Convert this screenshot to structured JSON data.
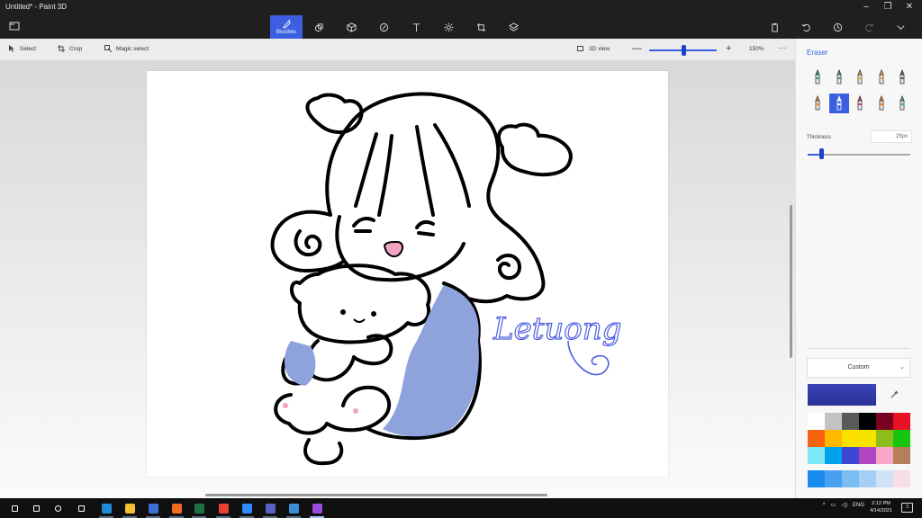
{
  "window": {
    "title": "Untitled* - Paint 3D",
    "minimize_glyph": "–",
    "maximize_glyph": "❐",
    "close_glyph": "✕"
  },
  "main_toolbar": {
    "menu_icon": "hamburger-folder-icon",
    "tools": [
      {
        "name": "brushes",
        "label": "Brushes",
        "icon": "brush-icon",
        "active": true
      },
      {
        "name": "2d-shapes",
        "label": "",
        "icon": "2d-shapes-icon",
        "active": false
      },
      {
        "name": "3d-shapes",
        "label": "",
        "icon": "cube-icon",
        "active": false
      },
      {
        "name": "stickers",
        "label": "",
        "icon": "sticker-icon",
        "active": false
      },
      {
        "name": "text",
        "label": "",
        "icon": "text-icon",
        "active": false
      },
      {
        "name": "effects",
        "label": "",
        "icon": "sun-effects-icon",
        "active": false
      },
      {
        "name": "canvas",
        "label": "",
        "icon": "canvas-icon",
        "active": false
      },
      {
        "name": "3d-library",
        "label": "",
        "icon": "library-icon",
        "active": false
      }
    ],
    "right_actions": [
      "paste-icon",
      "undo-icon",
      "history-icon",
      "redo-icon",
      "chevron-down-icon"
    ]
  },
  "sub_toolbar": {
    "select_label": "Select",
    "crop_label": "Crop",
    "magic_select_label": "Magic select",
    "view_3d_label": "3D view",
    "zoom_minus": "—",
    "zoom_plus": "+",
    "zoom_value": "150%",
    "more": "···"
  },
  "drawing": {
    "signature": "Letuong"
  },
  "panel": {
    "title": "Eraser",
    "brushes": [
      {
        "name": "marker",
        "color": "#2a9d8f"
      },
      {
        "name": "calligraphy-pen",
        "color": "#3a9a8a"
      },
      {
        "name": "oil-brush",
        "color": "#e3a21a"
      },
      {
        "name": "watercolor",
        "color": "#f2a33a"
      },
      {
        "name": "pixel-pen",
        "color": "#555f6b"
      },
      {
        "name": "pencil",
        "color": "#e28a1f"
      },
      {
        "name": "eraser",
        "color": "#ffffff",
        "selected": true
      },
      {
        "name": "crayon",
        "color": "#e03b5a"
      },
      {
        "name": "spray-can",
        "color": "#f07a1a"
      },
      {
        "name": "fill",
        "color": "#4aa7a0"
      }
    ],
    "thickness_label": "Thickness",
    "thickness_value": "25px",
    "thickness_fraction": 0.14,
    "color_mode": "Custom",
    "current_color": "#3b44b8",
    "palette": [
      "#ffffff",
      "#c3c3c3",
      "#595959",
      "#000000",
      "#7a0020",
      "#e81123",
      "#f7630c",
      "#ffb900",
      "#fce100",
      "#f7e300",
      "#8cbd18",
      "#16c60c",
      "#7ce8f5",
      "#00a2ed",
      "#3f46d4",
      "#b146c2",
      "#f7a8c6",
      "#b57f5b"
    ],
    "palette_custom": [
      "#1a8cf0",
      "#4aa0f0",
      "#7bbcf2",
      "#a5cff4",
      "#cfe2f6",
      "#f8dce6"
    ]
  },
  "taskbar": {
    "apps": [
      {
        "name": "start",
        "color": "#ffffff"
      },
      {
        "name": "search",
        "color": "#ffffff"
      },
      {
        "name": "cortana",
        "color": "#ffffff"
      },
      {
        "name": "task-view",
        "color": "#ffffff"
      },
      {
        "name": "edge",
        "color": "#1f8ad6"
      },
      {
        "name": "file-explorer",
        "color": "#f2c230"
      },
      {
        "name": "store",
        "color": "#3a6fd6"
      },
      {
        "name": "firefox",
        "color": "#f26b21"
      },
      {
        "name": "excel",
        "color": "#1e7145"
      },
      {
        "name": "chrome",
        "color": "#e94235"
      },
      {
        "name": "zoom",
        "color": "#2d8cff"
      },
      {
        "name": "teams",
        "color": "#5b5fc7"
      },
      {
        "name": "photos",
        "color": "#3b8fd6"
      },
      {
        "name": "paint-3d",
        "color": "#9a4ce0"
      }
    ],
    "tray_lang": "ENG",
    "time": "2:12 PM",
    "date": "4/14/2021",
    "notifications": "3"
  }
}
